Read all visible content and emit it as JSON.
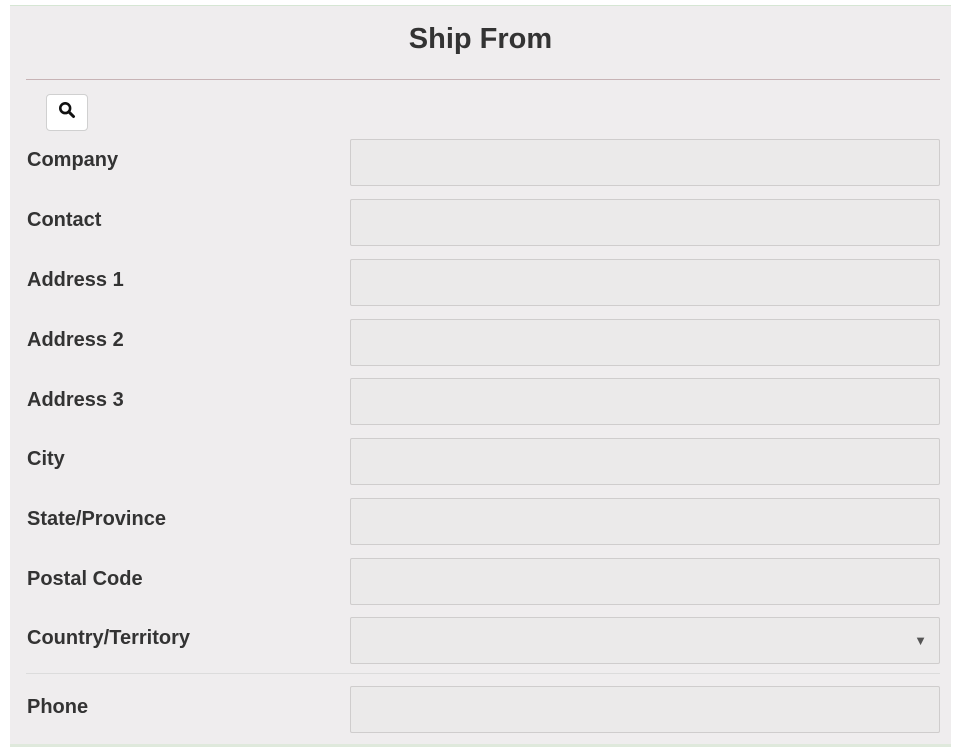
{
  "section": {
    "title": "Ship From"
  },
  "lookup": {
    "icon": "search-icon"
  },
  "fields": [
    {
      "label": "Company",
      "value": ""
    },
    {
      "label": "Contact",
      "value": ""
    },
    {
      "label": "Address 1",
      "value": ""
    },
    {
      "label": "Address 2",
      "value": ""
    },
    {
      "label": "Address 3",
      "value": ""
    },
    {
      "label": "City",
      "value": ""
    },
    {
      "label": "State/Province",
      "value": ""
    },
    {
      "label": "Postal Code",
      "value": ""
    }
  ],
  "country": {
    "label": "Country/Territory",
    "selected": "",
    "arrow": "▼"
  },
  "phone": {
    "label": "Phone",
    "value": ""
  }
}
